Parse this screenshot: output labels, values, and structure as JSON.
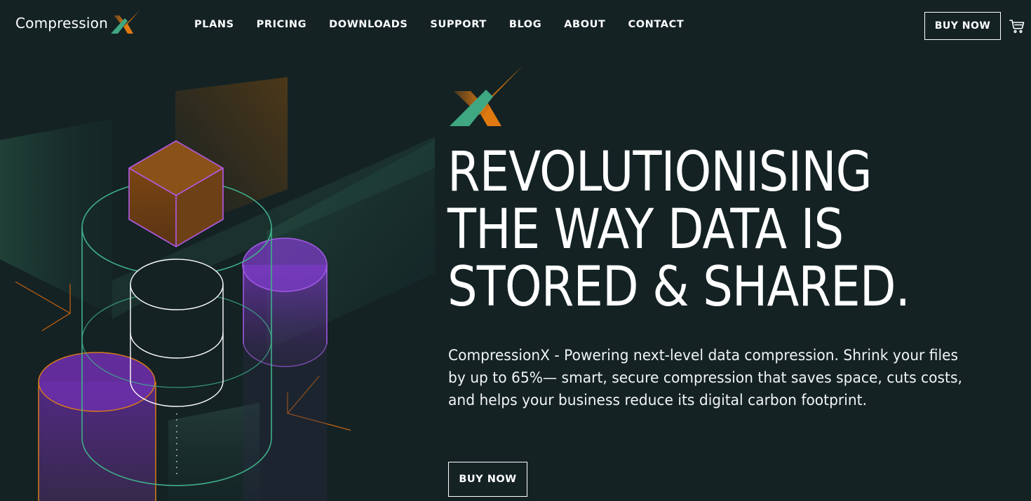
{
  "brand": {
    "name": "CompressionX",
    "colors": {
      "background": "#142224",
      "orange": "#e07a10",
      "green": "#3fa882",
      "purple": "#8c3fd9"
    }
  },
  "nav": {
    "logo_text": "Compression",
    "links": [
      "PLANS",
      "PRICING",
      "DOWNLOADS",
      "SUPPORT",
      "BLOG",
      "ABOUT",
      "CONTACT"
    ],
    "buy_label": "BUY NOW",
    "cart_icon": "cart-icon"
  },
  "hero": {
    "title_lines": [
      "REVOLUTIONISING",
      "THE WAY DATA IS",
      "STORED & SHARED."
    ],
    "description": "CompressionX - Powering next-level data compression. Shrink your files by up to 65%— smart, secure compression that saves space, cuts costs, and helps your business reduce its digital carbon footprint.",
    "buy_label": "BUY NOW"
  }
}
